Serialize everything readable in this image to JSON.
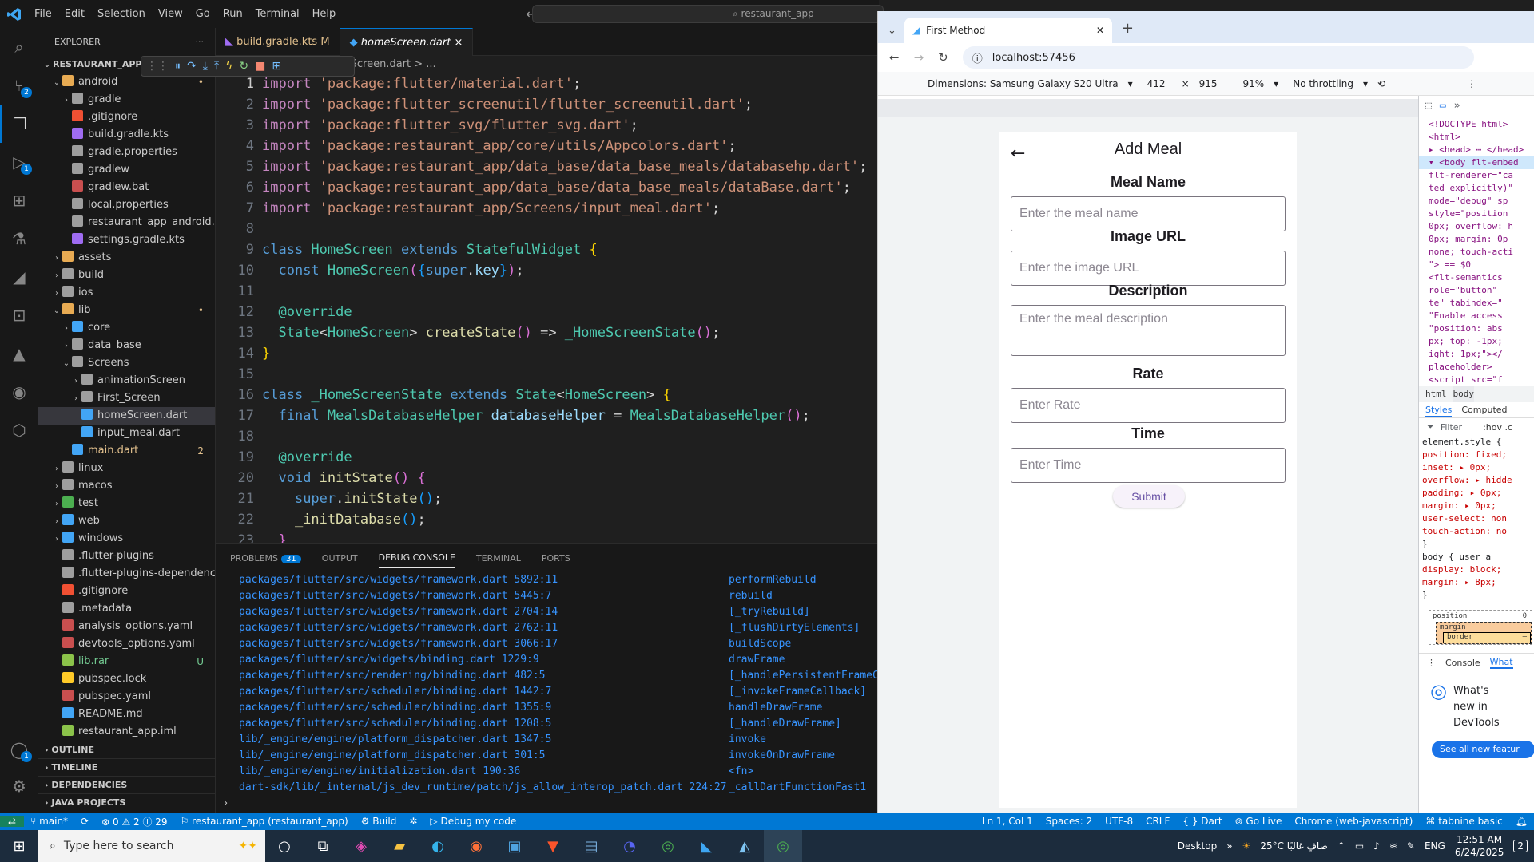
{
  "vscode": {
    "menu": [
      "File",
      "Edit",
      "Selection",
      "View",
      "Go",
      "Run",
      "Terminal",
      "Help"
    ],
    "command_center": "restaurant_app",
    "explorer_title": "EXPLORER",
    "project": "RESTAURANT_APP",
    "tabs": [
      {
        "label": "build.gradle.kts",
        "badge": "M"
      },
      {
        "label": "homeScreen.dart",
        "badge": "×"
      }
    ],
    "breadcrumb": "omeScreen.dart  > ...",
    "tree": [
      {
        "label": "android",
        "indent": 1,
        "chev": "⌄",
        "color": "#e8ab53",
        "st": "•"
      },
      {
        "label": "gradle",
        "indent": 2,
        "chev": "›",
        "color": "#9e9e9e",
        "st": ""
      },
      {
        "label": ".gitignore",
        "indent": 2,
        "chev": "",
        "color": "#f05033",
        "st": ""
      },
      {
        "label": "build.gradle.kts",
        "indent": 2,
        "chev": "",
        "color": "#9f6cf2",
        "st": ""
      },
      {
        "label": "gradle.properties",
        "indent": 2,
        "chev": "",
        "color": "#9e9e9e",
        "st": ""
      },
      {
        "label": "gradlew",
        "indent": 2,
        "chev": "",
        "color": "#9e9e9e",
        "st": ""
      },
      {
        "label": "gradlew.bat",
        "indent": 2,
        "chev": "",
        "color": "#c94f4f",
        "st": ""
      },
      {
        "label": "local.properties",
        "indent": 2,
        "chev": "",
        "color": "#9e9e9e",
        "st": ""
      },
      {
        "label": "restaurant_app_android.iml",
        "indent": 2,
        "chev": "",
        "color": "#9e9e9e",
        "st": ""
      },
      {
        "label": "settings.gradle.kts",
        "indent": 2,
        "chev": "",
        "color": "#9f6cf2",
        "st": ""
      },
      {
        "label": "assets",
        "indent": 1,
        "chev": "›",
        "color": "#e8ab53",
        "st": ""
      },
      {
        "label": "build",
        "indent": 1,
        "chev": "›",
        "color": "#9e9e9e",
        "st": ""
      },
      {
        "label": "ios",
        "indent": 1,
        "chev": "›",
        "color": "#9e9e9e",
        "st": ""
      },
      {
        "label": "lib",
        "indent": 1,
        "chev": "⌄",
        "color": "#e8ab53",
        "st": "•"
      },
      {
        "label": "core",
        "indent": 2,
        "chev": "›",
        "color": "#42a5f5",
        "st": ""
      },
      {
        "label": "data_base",
        "indent": 2,
        "chev": "›",
        "color": "#9e9e9e",
        "st": ""
      },
      {
        "label": "Screens",
        "indent": 2,
        "chev": "⌄",
        "color": "#9e9e9e",
        "st": ""
      },
      {
        "label": "animationScreen",
        "indent": 3,
        "chev": "›",
        "color": "#9e9e9e",
        "st": ""
      },
      {
        "label": "First_Screen",
        "indent": 3,
        "chev": "›",
        "color": "#9e9e9e",
        "st": ""
      },
      {
        "label": "homeScreen.dart",
        "indent": 3,
        "chev": "",
        "color": "#42a5f5",
        "st": "",
        "sel": true
      },
      {
        "label": "input_meal.dart",
        "indent": 3,
        "chev": "",
        "color": "#42a5f5",
        "st": ""
      },
      {
        "label": "main.dart",
        "indent": 2,
        "chev": "",
        "color": "#42a5f5",
        "st": "2"
      },
      {
        "label": "linux",
        "indent": 1,
        "chev": "›",
        "color": "#9e9e9e",
        "st": ""
      },
      {
        "label": "macos",
        "indent": 1,
        "chev": "›",
        "color": "#9e9e9e",
        "st": ""
      },
      {
        "label": "test",
        "indent": 1,
        "chev": "›",
        "color": "#4caf50",
        "st": ""
      },
      {
        "label": "web",
        "indent": 1,
        "chev": "›",
        "color": "#42a5f5",
        "st": ""
      },
      {
        "label": "windows",
        "indent": 1,
        "chev": "›",
        "color": "#42a5f5",
        "st": ""
      },
      {
        "label": ".flutter-plugins",
        "indent": 1,
        "chev": "",
        "color": "#9e9e9e",
        "st": ""
      },
      {
        "label": ".flutter-plugins-dependenc...",
        "indent": 1,
        "chev": "",
        "color": "#9e9e9e",
        "st": ""
      },
      {
        "label": ".gitignore",
        "indent": 1,
        "chev": "",
        "color": "#f05033",
        "st": ""
      },
      {
        "label": ".metadata",
        "indent": 1,
        "chev": "",
        "color": "#9e9e9e",
        "st": ""
      },
      {
        "label": "analysis_options.yaml",
        "indent": 1,
        "chev": "",
        "color": "#c94f4f",
        "st": ""
      },
      {
        "label": "devtools_options.yaml",
        "indent": 1,
        "chev": "",
        "color": "#c94f4f",
        "st": ""
      },
      {
        "label": "lib.rar",
        "indent": 1,
        "chev": "",
        "color": "#8bc34a",
        "st": "U"
      },
      {
        "label": "pubspec.lock",
        "indent": 1,
        "chev": "",
        "color": "#ffca28",
        "st": ""
      },
      {
        "label": "pubspec.yaml",
        "indent": 1,
        "chev": "",
        "color": "#c94f4f",
        "st": ""
      },
      {
        "label": "README.md",
        "indent": 1,
        "chev": "",
        "color": "#42a5f5",
        "st": ""
      },
      {
        "label": "restaurant_app.iml",
        "indent": 1,
        "chev": "",
        "color": "#8bc34a",
        "st": ""
      }
    ],
    "sections": [
      "OUTLINE",
      "TIMELINE",
      "DEPENDENCIES",
      "JAVA PROJECTS"
    ],
    "code": [
      [
        [
          "kw2",
          "import "
        ],
        [
          "str",
          "'package:flutter/material.dart'"
        ],
        [
          "pl",
          ";"
        ]
      ],
      [
        [
          "kw2",
          "import "
        ],
        [
          "str",
          "'package:flutter_screenutil/flutter_screenutil.dart'"
        ],
        [
          "pl",
          ";"
        ]
      ],
      [
        [
          "kw2",
          "import "
        ],
        [
          "str",
          "'package:flutter_svg/flutter_svg.dart'"
        ],
        [
          "pl",
          ";"
        ]
      ],
      [
        [
          "kw2",
          "import "
        ],
        [
          "str",
          "'package:restaurant_app/core/utils/Appcolors.dart'"
        ],
        [
          "pl",
          ";"
        ]
      ],
      [
        [
          "kw2",
          "import "
        ],
        [
          "str",
          "'package:restaurant_app/data_base/data_base_meals/databasehp.dart'"
        ],
        [
          "pl",
          ";"
        ]
      ],
      [
        [
          "kw2",
          "import "
        ],
        [
          "str",
          "'package:restaurant_app/data_base/data_base_meals/dataBase.dart'"
        ],
        [
          "pl",
          ";"
        ]
      ],
      [
        [
          "kw2",
          "import "
        ],
        [
          "str",
          "'package:restaurant_app/Screens/input_meal.dart'"
        ],
        [
          "pl",
          ";"
        ]
      ],
      [],
      [
        [
          "kw",
          "class "
        ],
        [
          "cls",
          "HomeScreen "
        ],
        [
          "kw",
          "extends "
        ],
        [
          "cls",
          "StatefulWidget "
        ],
        [
          "br",
          "{"
        ]
      ],
      [
        [
          "pl",
          "  "
        ],
        [
          "kw",
          "const "
        ],
        [
          "cls",
          "HomeScreen"
        ],
        [
          "br2",
          "("
        ],
        [
          "br3",
          "{"
        ],
        [
          "kw",
          "super"
        ],
        [
          "pl",
          "."
        ],
        [
          "var",
          "key"
        ],
        [
          "br3",
          "}"
        ],
        [
          "br2",
          ")"
        ],
        [
          "pl",
          ";"
        ]
      ],
      [],
      [
        [
          "pl",
          "  "
        ],
        [
          "cls",
          "@override"
        ]
      ],
      [
        [
          "pl",
          "  "
        ],
        [
          "cls",
          "State"
        ],
        [
          "pl",
          "<"
        ],
        [
          "cls",
          "HomeScreen"
        ],
        [
          "pl",
          "> "
        ],
        [
          "fn",
          "createState"
        ],
        [
          "br2",
          "()"
        ],
        [
          "pl",
          " => "
        ],
        [
          "cls",
          "_HomeScreenState"
        ],
        [
          "br2",
          "()"
        ],
        [
          "pl",
          ";"
        ]
      ],
      [
        [
          "br",
          "}"
        ]
      ],
      [],
      [
        [
          "kw",
          "class "
        ],
        [
          "cls",
          "_HomeScreenState "
        ],
        [
          "kw",
          "extends "
        ],
        [
          "cls",
          "State"
        ],
        [
          "pl",
          "<"
        ],
        [
          "cls",
          "HomeScreen"
        ],
        [
          "pl",
          "> "
        ],
        [
          "br",
          "{"
        ]
      ],
      [
        [
          "pl",
          "  "
        ],
        [
          "kw",
          "final "
        ],
        [
          "cls",
          "MealsDatabaseHelper "
        ],
        [
          "var",
          "databaseHelper"
        ],
        [
          "pl",
          " = "
        ],
        [
          "cls",
          "MealsDatabaseHelper"
        ],
        [
          "br2",
          "()"
        ],
        [
          "pl",
          ";"
        ]
      ],
      [],
      [
        [
          "pl",
          "  "
        ],
        [
          "cls",
          "@override"
        ]
      ],
      [
        [
          "pl",
          "  "
        ],
        [
          "kw",
          "void "
        ],
        [
          "fn",
          "initState"
        ],
        [
          "br2",
          "() "
        ],
        [
          "br2",
          "{"
        ]
      ],
      [
        [
          "pl",
          "    "
        ],
        [
          "kw",
          "super"
        ],
        [
          "pl",
          "."
        ],
        [
          "fn",
          "initState"
        ],
        [
          "br3",
          "()"
        ],
        [
          "pl",
          ";"
        ]
      ],
      [
        [
          "pl",
          "    "
        ],
        [
          "fn",
          "_initDatabase"
        ],
        [
          "br3",
          "()"
        ],
        [
          "pl",
          ";"
        ]
      ],
      [
        [
          "pl",
          "  "
        ],
        [
          "br2",
          "}"
        ]
      ]
    ],
    "panel_tabs": [
      {
        "label": "PROBLEMS",
        "badge": "31"
      },
      {
        "label": "OUTPUT",
        "badge": ""
      },
      {
        "label": "DEBUG CONSOLE",
        "badge": ""
      },
      {
        "label": "TERMINAL",
        "badge": ""
      },
      {
        "label": "PORTS",
        "badge": ""
      }
    ],
    "debug_lines": [
      [
        "packages/flutter/src/widgets/framework.dart 5892:11",
        "performRebuild"
      ],
      [
        "packages/flutter/src/widgets/framework.dart 5445:7",
        "rebuild"
      ],
      [
        "packages/flutter/src/widgets/framework.dart 2704:14",
        "[_tryRebuild]"
      ],
      [
        "packages/flutter/src/widgets/framework.dart 2762:11",
        "[_flushDirtyElements]"
      ],
      [
        "packages/flutter/src/widgets/framework.dart 3066:17",
        "buildScope"
      ],
      [
        "packages/flutter/src/widgets/binding.dart 1229:9",
        "drawFrame"
      ],
      [
        "packages/flutter/src/rendering/binding.dart 482:5",
        "[_handlePersistentFrameC"
      ],
      [
        "packages/flutter/src/scheduler/binding.dart 1442:7",
        "[_invokeFrameCallback]"
      ],
      [
        "packages/flutter/src/scheduler/binding.dart 1355:9",
        "handleDrawFrame"
      ],
      [
        "packages/flutter/src/scheduler/binding.dart 1208:5",
        "[_handleDrawFrame]"
      ],
      [
        "lib/_engine/engine/platform_dispatcher.dart 1347:5",
        "invoke"
      ],
      [
        "lib/_engine/engine/platform_dispatcher.dart 301:5",
        "invokeOnDrawFrame"
      ],
      [
        "lib/_engine/engine/initialization.dart 190:36",
        "<fn>"
      ],
      [
        "dart-sdk/lib/_internal/js_dev_runtime/patch/js_allow_interop_patch.dart 224:27",
        "_callDartFunctionFast1"
      ]
    ],
    "status": {
      "branch": "main*",
      "problems": "⊗ 0 ⚠ 2 ⓘ 29",
      "target": "restaurant_app (restaurant_app)",
      "build": "Build",
      "debug": "Debug my code",
      "pos": "Ln 1, Col 1",
      "spaces": "Spaces: 2",
      "enc": "UTF-8",
      "eol": "CRLF",
      "lang": "{ } Dart",
      "golive": "Go Live",
      "device": "Chrome (web-javascript)",
      "tabnine": "tabnine basic"
    }
  },
  "browser": {
    "tab_title": "First Method",
    "url": "localhost:57456",
    "device": "Dimensions: Samsung Galaxy S20 Ultra",
    "width": "412",
    "x": "×",
    "height": "915",
    "zoom": "91%",
    "throttle": "No throttling"
  },
  "app": {
    "title": "Add Meal",
    "meal_name_label": "Meal Name",
    "meal_name_placeholder": "Enter the meal name",
    "image_label": "Image URL",
    "image_placeholder": "Enter the image URL",
    "desc_label": "Description",
    "desc_placeholder": "Enter the meal description",
    "rate_label": "Rate",
    "rate_placeholder": "Enter Rate",
    "time_label": "Time",
    "time_placeholder": "Enter Time",
    "submit": "Submit"
  },
  "devtools": {
    "lines": [
      "<!DOCTYPE html>",
      "<html>",
      "▸ <head> ⋯ </head>",
      "▾ <body flt-embed",
      "  flt-renderer=\"ca",
      "  ted explicitly)\"",
      "  mode=\"debug\" sp",
      "  style=\"position",
      "  0px; overflow: h",
      "  0px; margin: 0p",
      "  none; touch-acti",
      "  \"> == $0",
      "  <flt-semantics",
      "  role=\"button\"",
      "  te\" tabindex=\"",
      "  \"Enable access",
      "  \"position: abs",
      "  px; top: -1px;",
      "  ight: 1px;\"></",
      "  placeholder>",
      "  <script src=\"f"
    ],
    "crumbs": [
      "html",
      "body"
    ],
    "tabs": [
      "Styles",
      "Computed"
    ],
    "filter": "Filter",
    "hov": ":hov .c",
    "style_lines": [
      "element.style {",
      "  position: fixed;",
      "  inset: ▸ 0px;",
      "  overflow: ▸ hidde",
      "  padding: ▸ 0px;",
      "  margin: ▸ 0px;",
      "  user-select: non",
      "  touch-action: no",
      "}",
      "body {        user a",
      "  display: block;",
      "  margin: ▸ 8px;",
      "}"
    ],
    "box": [
      "position",
      "0",
      "margin",
      "–",
      "border",
      "–"
    ],
    "drawer": [
      "Console",
      "What"
    ],
    "whatsnew": "What's new in DevTools",
    "see_all": "See all new featur"
  },
  "taskbar": {
    "search_placeholder": "Type here to search",
    "desktop": "Desktop",
    "weather": "25°C  صافٍ غالبًا",
    "lang": "ENG",
    "time": "12:51 AM",
    "date": "6/24/2025",
    "notif": "2"
  }
}
